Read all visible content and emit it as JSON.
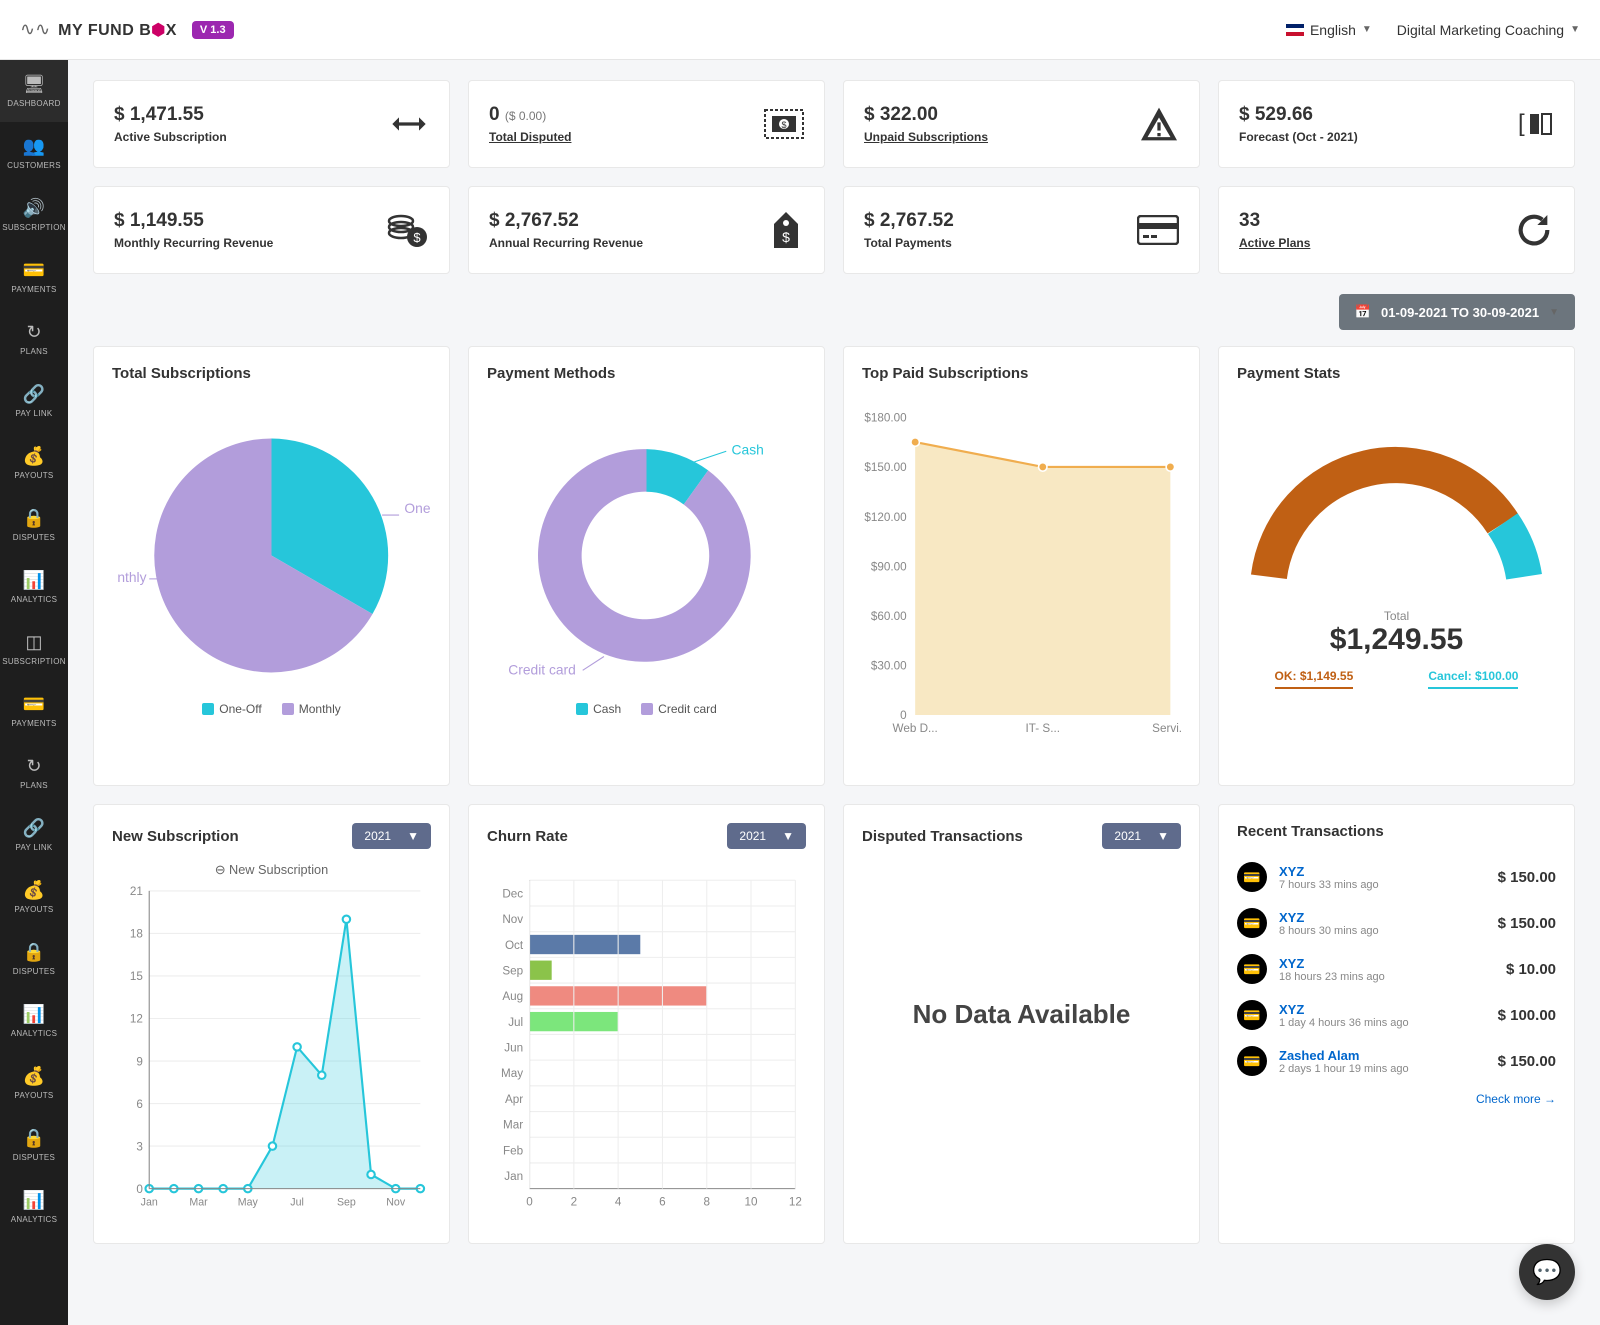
{
  "header": {
    "logo_text_prefix": "MY FUND B",
    "logo_text_suffix": "X",
    "version": "V 1.3",
    "language": "English",
    "account": "Digital Marketing Coaching"
  },
  "sidebar": {
    "items": [
      {
        "icon": "🖥",
        "label": "Dashboard"
      },
      {
        "icon": "👥",
        "label": "Customers"
      },
      {
        "icon": "🔊",
        "label": "Subscription"
      },
      {
        "icon": "💳",
        "label": "Payments"
      },
      {
        "icon": "↻",
        "label": "Plans"
      },
      {
        "icon": "🔗",
        "label": "Pay Link"
      },
      {
        "icon": "💰",
        "label": "Payouts"
      },
      {
        "icon": "🔒",
        "label": "Disputes"
      },
      {
        "icon": "📊",
        "label": "Analytics"
      },
      {
        "icon": "◫",
        "label": "Subscription"
      },
      {
        "icon": "💳",
        "label": "Payments"
      },
      {
        "icon": "↻",
        "label": "Plans"
      },
      {
        "icon": "🔗",
        "label": "Pay Link"
      },
      {
        "icon": "💰",
        "label": "Payouts"
      },
      {
        "icon": "🔒",
        "label": "Disputes"
      },
      {
        "icon": "📊",
        "label": "Analytics"
      },
      {
        "icon": "💰",
        "label": "Payouts"
      },
      {
        "icon": "🔒",
        "label": "Disputes"
      },
      {
        "icon": "📊",
        "label": "Analytics"
      }
    ]
  },
  "kpis": [
    {
      "value": "$ 1,471.55",
      "label": "Active Subscription",
      "underline": false,
      "icon": "swap"
    },
    {
      "value": "0",
      "sub": "($ 0.00)",
      "label": "Total Disputed",
      "underline": true,
      "icon": "money"
    },
    {
      "value": "$ 322.00",
      "label": "Unpaid Subscriptions",
      "underline": true,
      "icon": "warning"
    },
    {
      "value": "$ 529.66",
      "label": "Forecast (Oct - 2021)",
      "underline": false,
      "icon": "bracket"
    },
    {
      "value": "$ 1,149.55",
      "label": "Monthly Recurring Revenue",
      "underline": false,
      "icon": "coins"
    },
    {
      "value": "$ 2,767.52",
      "label": "Annual Recurring Revenue",
      "underline": false,
      "icon": "tag"
    },
    {
      "value": "$ 2,767.52",
      "label": "Total Payments",
      "underline": false,
      "icon": "card"
    },
    {
      "value": "33",
      "label": "Active Plans",
      "underline": true,
      "icon": "refresh"
    }
  ],
  "date_range": "01-09-2021 TO 30-09-2021",
  "charts": {
    "total_subscriptions": {
      "title": "Total Subscriptions",
      "legend": [
        {
          "label": "One-Off",
          "color": "#26c6da"
        },
        {
          "label": "Monthly",
          "color": "#b29ddb"
        }
      ],
      "labels": {
        "one": "One",
        "monthly": "nthly"
      }
    },
    "payment_methods": {
      "title": "Payment Methods",
      "legend": [
        {
          "label": "Cash",
          "color": "#26c6da"
        },
        {
          "label": "Credit card",
          "color": "#b29ddb"
        }
      ],
      "labels": {
        "cash": "Cash",
        "cc": "Credit card"
      }
    },
    "top_paid": {
      "title": "Top Paid Subscriptions"
    },
    "payment_stats": {
      "title": "Payment Stats",
      "total_label": "Total",
      "total_value": "$1,249.55",
      "ok": "OK: $1,149.55",
      "cancel": "Cancel: $100.00"
    },
    "new_subscription": {
      "title": "New Subscription",
      "year": "2021",
      "legend": "New Subscription"
    },
    "churn_rate": {
      "title": "Churn Rate",
      "year": "2021"
    },
    "disputed": {
      "title": "Disputed Transactions",
      "year": "2021",
      "message": "No Data Available"
    },
    "recent": {
      "title": "Recent Transactions",
      "more": "Check more →"
    }
  },
  "transactions": [
    {
      "name": "XYZ",
      "time": "7 hours 33 mins ago",
      "amount": "$ 150.00"
    },
    {
      "name": "XYZ",
      "time": "8 hours 30 mins ago",
      "amount": "$ 150.00"
    },
    {
      "name": "XYZ",
      "time": "18 hours 23 mins ago",
      "amount": "$ 10.00"
    },
    {
      "name": "XYZ",
      "time": "1 day 4 hours 36 mins ago",
      "amount": "$ 100.00"
    },
    {
      "name": "Zashed Alam",
      "time": "2 days 1 hour 19 mins ago",
      "amount": "$ 150.00"
    }
  ],
  "chart_data": [
    {
      "id": "total_subscriptions",
      "type": "pie",
      "series": [
        {
          "name": "One-Off",
          "value": 35,
          "color": "#26c6da"
        },
        {
          "name": "Monthly",
          "value": 65,
          "color": "#b29ddb"
        }
      ]
    },
    {
      "id": "payment_methods",
      "type": "donut",
      "series": [
        {
          "name": "Cash",
          "value": 10,
          "color": "#26c6da"
        },
        {
          "name": "Credit card",
          "value": 90,
          "color": "#b29ddb"
        }
      ]
    },
    {
      "id": "top_paid_subscriptions",
      "type": "line",
      "categories": [
        "Web D...",
        "IT- S...",
        "Servi..."
      ],
      "values": [
        165,
        150,
        150
      ],
      "ylim": [
        0,
        180
      ],
      "yticks": [
        0,
        30,
        60,
        90,
        120,
        150,
        180
      ],
      "fill": true,
      "color": "#f0ad4e"
    },
    {
      "id": "payment_stats",
      "type": "gauge",
      "total": 1249.55,
      "series": [
        {
          "name": "OK",
          "value": 1149.55,
          "color": "#c06014"
        },
        {
          "name": "Cancel",
          "value": 100.0,
          "color": "#26c6da"
        }
      ]
    },
    {
      "id": "new_subscription",
      "type": "area",
      "categories": [
        "Jan",
        "Feb",
        "Mar",
        "Apr",
        "May",
        "Jun",
        "Jul",
        "Aug",
        "Sep",
        "Oct",
        "Nov",
        "Dec"
      ],
      "values": [
        0,
        0,
        0,
        0,
        0,
        3,
        10,
        8,
        19,
        1,
        0,
        0
      ],
      "ylim": [
        0,
        21
      ],
      "yticks": [
        0,
        3,
        6,
        9,
        12,
        15,
        18,
        21
      ],
      "color": "#26c6da"
    },
    {
      "id": "churn_rate",
      "type": "bar_horizontal",
      "categories": [
        "Jan",
        "Feb",
        "Mar",
        "Apr",
        "May",
        "Jun",
        "Jul",
        "Aug",
        "Sep",
        "Oct",
        "Nov",
        "Dec"
      ],
      "series": [
        {
          "month": "Oct",
          "value": 5,
          "color": "#5b7aa8"
        },
        {
          "month": "Sep",
          "value": 1,
          "color": "#8bc34a"
        },
        {
          "month": "Aug",
          "value": 8,
          "color": "#ef8a80"
        },
        {
          "month": "Jul",
          "value": 4,
          "color": "#7ce67c"
        }
      ],
      "xlim": [
        0,
        12
      ],
      "xticks": [
        0,
        2,
        4,
        6,
        8,
        10,
        12
      ]
    }
  ]
}
